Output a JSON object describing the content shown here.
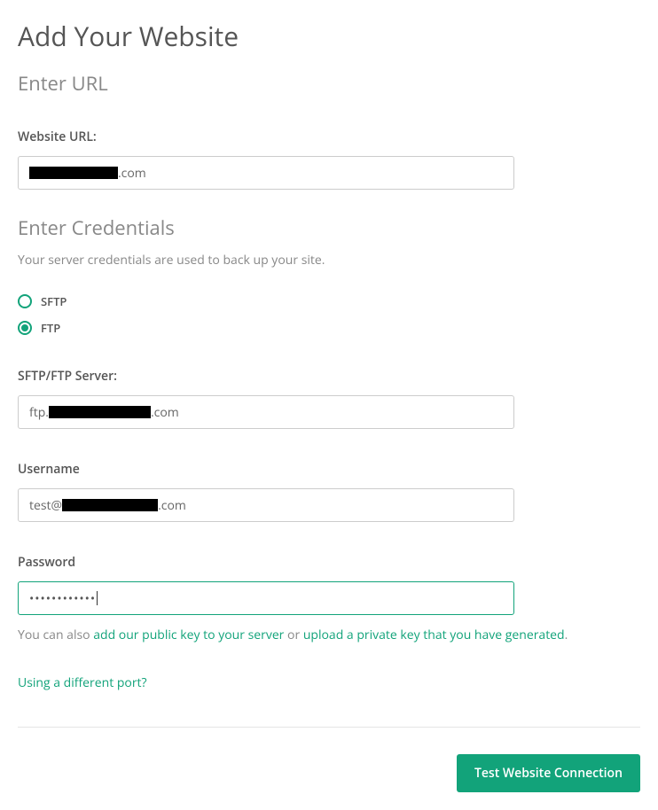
{
  "page": {
    "title": "Add Your Website"
  },
  "url_section": {
    "title": "Enter URL",
    "label": "Website URL:",
    "value_suffix": ".com"
  },
  "credentials_section": {
    "title": "Enter Credentials",
    "subtitle": "Your server credentials are used to back up your site.",
    "radio": {
      "sftp": "SFTP",
      "ftp": "FTP"
    },
    "server": {
      "label": "SFTP/FTP Server:",
      "value_prefix": "ftp.",
      "value_suffix": ".com"
    },
    "username": {
      "label": "Username",
      "value_prefix": "test@",
      "value_suffix": ".com"
    },
    "password": {
      "label": "Password",
      "value": "••••••••••••",
      "help_prefix": "You can also ",
      "help_link1": "add our public key to your server",
      "help_mid": " or ",
      "help_link2": "upload a private key that you have generated",
      "help_suffix": "."
    },
    "port_link": "Using a different port?"
  },
  "actions": {
    "test_button": "Test Website Connection"
  }
}
